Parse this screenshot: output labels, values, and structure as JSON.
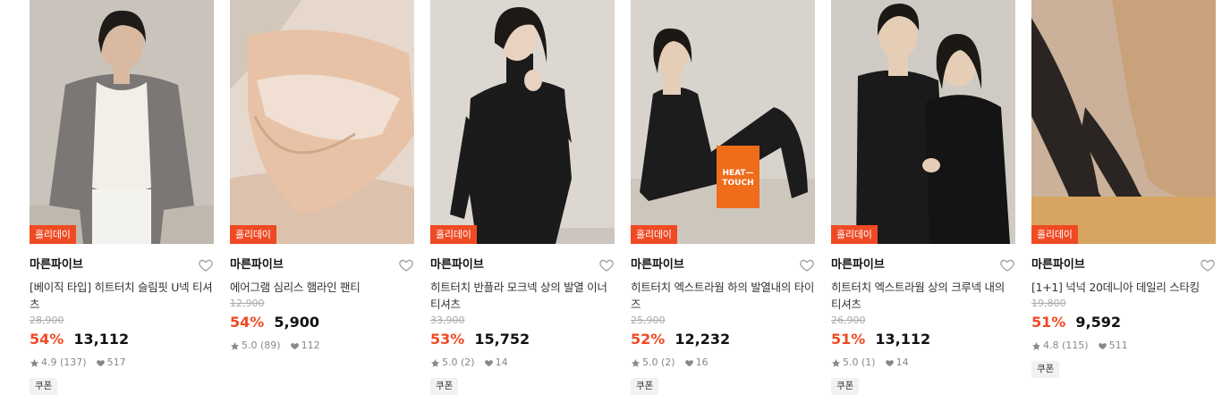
{
  "products": [
    {
      "badge": "홀리데이",
      "brand": "마른파이브",
      "name": "[베이직 타입] 히트터치 슬림핏 U넥 티셔츠",
      "original_price": "28,900",
      "discount": "54%",
      "price": "13,112",
      "rating": "4.9",
      "reviews": "(137)",
      "likes": "517",
      "coupon": "쿠폰",
      "colors": {
        "bg": "#c9c3bb",
        "figure": "#7a7775",
        "accent": "#f2efe9"
      }
    },
    {
      "badge": "홀리데이",
      "brand": "마른파이브",
      "name": "에어그램 심리스 햄라인 팬티",
      "original_price": "12,900",
      "discount": "54%",
      "price": "5,900",
      "rating": "5.0",
      "reviews": "(89)",
      "likes": "112",
      "coupon": "",
      "colors": {
        "bg": "#e6d8cc",
        "figure": "#e7c2a6",
        "accent": "#f0dfd2"
      }
    },
    {
      "badge": "홀리데이",
      "brand": "마른파이브",
      "name": "히트터치 반플라 모크넥 상의 발열 이너 티셔츠",
      "original_price": "33,900",
      "discount": "53%",
      "price": "15,752",
      "rating": "5.0",
      "reviews": "(2)",
      "likes": "14",
      "coupon": "쿠폰",
      "colors": {
        "bg": "#dcd7d0",
        "figure": "#1b1b1b",
        "accent": "#e9d2bf"
      }
    },
    {
      "badge": "홀리데이",
      "brand": "마른파이브",
      "name": "히트터치 엑스트라웜 하의 발열내의 타이즈",
      "original_price": "25,900",
      "discount": "52%",
      "price": "12,232",
      "rating": "5.0",
      "reviews": "(2)",
      "likes": "16",
      "coupon": "쿠폰",
      "colors": {
        "bg": "#d8d3cc",
        "figure": "#1c1c1c",
        "accent": "#ef6c1a"
      },
      "box_text": [
        "HEAT—",
        "TOUCH"
      ]
    },
    {
      "badge": "홀리데이",
      "brand": "마른파이브",
      "name": "히트터치 엑스트라웜 상의 크루넥 내의 티셔츠",
      "original_price": "26,900",
      "discount": "51%",
      "price": "13,112",
      "rating": "5.0",
      "reviews": "(1)",
      "likes": "14",
      "coupon": "쿠폰",
      "colors": {
        "bg": "#cfcbc4",
        "figure": "#1a1a1a",
        "accent": "#e6cdb6"
      }
    },
    {
      "badge": "홀리데이",
      "brand": "마른파이브",
      "name": "[1+1] 넉넉 20데니아 데일리 스타킹",
      "original_price": "19,800",
      "discount": "51%",
      "price": "9,592",
      "rating": "4.8",
      "reviews": "(115)",
      "likes": "511",
      "coupon": "쿠폰",
      "colors": {
        "bg": "#d7a562",
        "figure": "#c9a27c",
        "accent": "#2a2522"
      }
    }
  ],
  "icons": {
    "wishlist": "heart-outline-icon",
    "rating": "star-icon",
    "likes": "heart-filled-icon"
  },
  "theme": {
    "accent": "#ef4a23",
    "muted": "#888888",
    "strike": "#aaaaaa"
  }
}
